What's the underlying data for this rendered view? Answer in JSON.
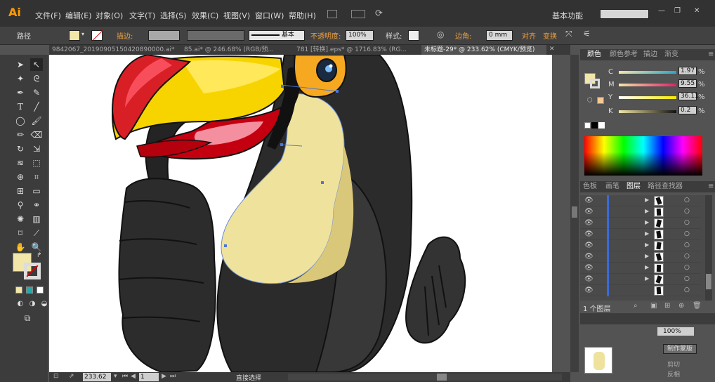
{
  "app": {
    "icon_text": "Ai"
  },
  "menu": [
    "文件(F)",
    "编辑(E)",
    "对象(O)",
    "文字(T)",
    "选择(S)",
    "效果(C)",
    "视图(V)",
    "窗口(W)",
    "帮助(H)"
  ],
  "workspace": {
    "label": "基本功能"
  },
  "control_bar": {
    "object_type": "路径",
    "stroke_label": "描边:",
    "stroke_style": "基本",
    "opacity_label": "不透明度:",
    "opacity_value": "100%",
    "style_label": "样式:",
    "corner_label": "边角:",
    "corner_value": "0 mm",
    "align_label": "对齐",
    "transform_label": "变换"
  },
  "document_tabs": [
    {
      "label": "9842067_20190905150420890000.ai*",
      "active": false
    },
    {
      "label": "85.ai* @ 246.68% (RGB/预...",
      "active": false
    },
    {
      "label": "781 [转换].eps* @ 1716.83% (RG...",
      "active": false
    },
    {
      "label": "未标题-29* @ 233.62% (CMYK/预览)",
      "active": true
    }
  ],
  "status_bar": {
    "zoom": "233.62",
    "page": "1",
    "tool_name": "直接选择"
  },
  "color_panel": {
    "tabs": [
      "颜色",
      "颜色参考",
      "描边",
      "渐变"
    ],
    "channels": [
      {
        "name": "C",
        "value": "1.97"
      },
      {
        "name": "M",
        "value": "9.55"
      },
      {
        "name": "Y",
        "value": "36.11"
      },
      {
        "name": "K",
        "value": "0.2"
      }
    ],
    "pct": "%",
    "fill_color": "#f2e6a8",
    "alt_swatch": "#f5c896"
  },
  "layers_panel": {
    "tabs": [
      "色板",
      "画笔",
      "图层",
      "路径查找器"
    ],
    "row_count": 9,
    "footer_text": "1 个图层"
  },
  "transparency_panel": {
    "opacity_value": "100%",
    "make_mask": "制作蒙版",
    "clip_label": "剪切",
    "invert_label": "反相"
  },
  "colors": {
    "menubar": "#323232",
    "panel": "#535353",
    "orange_accent": "#f0a040"
  }
}
